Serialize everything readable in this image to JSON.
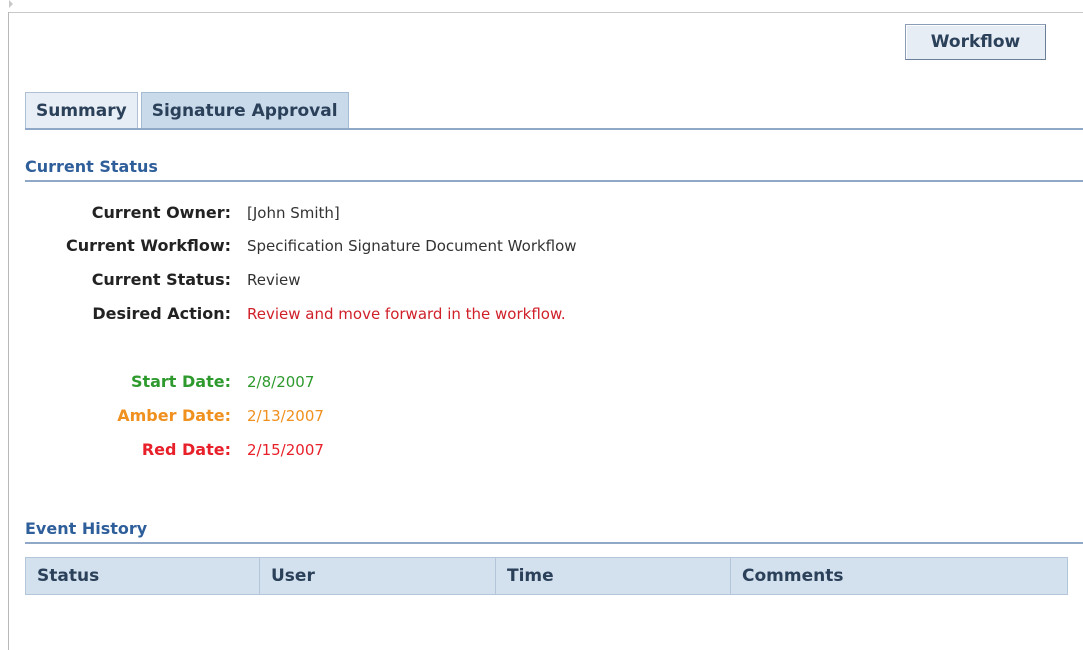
{
  "toolbar": {
    "workflow_label": "Workflow"
  },
  "tabs": [
    {
      "label": "Summary",
      "active": false
    },
    {
      "label": "Signature Approval",
      "active": true
    }
  ],
  "current_status_section": {
    "title": "Current Status",
    "fields": {
      "current_owner": {
        "label": "Current Owner:",
        "value": "[John Smith]"
      },
      "current_workflow": {
        "label": "Current Workflow:",
        "value": "Specification Signature Document Workflow"
      },
      "current_status": {
        "label": "Current Status:",
        "value": "Review"
      },
      "desired_action": {
        "label": "Desired Action:",
        "value": "Review and move forward in the workflow."
      }
    },
    "dates": {
      "start": {
        "label": "Start Date:",
        "value": "2/8/2007",
        "color": "#2e9a2e"
      },
      "amber": {
        "label": "Amber Date:",
        "value": "2/13/2007",
        "color": "#f0901e"
      },
      "red": {
        "label": "Red Date:",
        "value": "2/15/2007",
        "color": "#e8202a"
      }
    },
    "desired_action_color": "#d0202a"
  },
  "event_history_section": {
    "title": "Event History",
    "columns": [
      "Status",
      "User",
      "Time",
      "Comments"
    ]
  },
  "colors": {
    "section_title": "#2f5f9a",
    "grid_header_bg": "#d3e1ef",
    "active_tab_bg": "#c9daeb"
  }
}
